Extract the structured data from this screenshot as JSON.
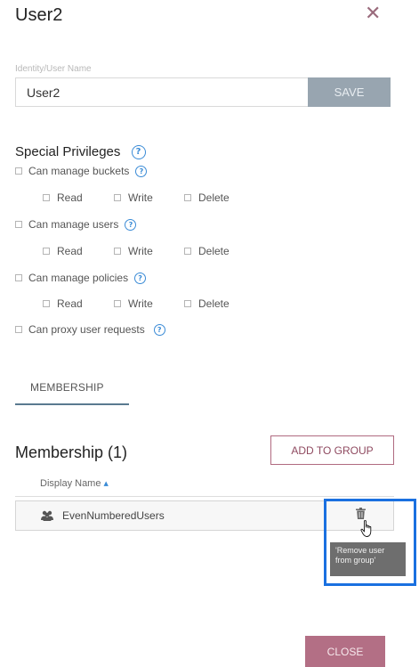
{
  "dialog": {
    "title": "User2",
    "close_glyph": "✕"
  },
  "identity": {
    "label": "Identity/User Name",
    "value": "User2",
    "save_label": "SAVE"
  },
  "privileges": {
    "title": "Special Privileges",
    "help_glyph": "?",
    "groups": [
      {
        "label": "Can manage buckets",
        "read": "Read",
        "write": "Write",
        "delete": "Delete"
      },
      {
        "label": "Can manage users",
        "read": "Read",
        "write": "Write",
        "delete": "Delete"
      },
      {
        "label": "Can manage policies",
        "read": "Read",
        "write": "Write",
        "delete": "Delete"
      }
    ],
    "proxy_label": "Can proxy user requests"
  },
  "tabs": {
    "membership": "MEMBERSHIP"
  },
  "membership": {
    "title": "Membership (1)",
    "add_label": "ADD TO GROUP",
    "column_header": "Display Name",
    "sort_glyph": "▲",
    "rows": [
      {
        "name": "EvenNumberedUsers"
      }
    ],
    "tooltip": "'Remove user from group'"
  },
  "footer": {
    "close_label": "CLOSE"
  },
  "colors": {
    "accent": "#b36f85",
    "highlight": "#1a70e0",
    "help": "#3a8bd6",
    "save": "#98a5b0"
  },
  "icons": [
    "close-icon",
    "help-icon",
    "group-icon",
    "trash-icon",
    "hand-cursor-icon",
    "sort-ascending-icon"
  ]
}
